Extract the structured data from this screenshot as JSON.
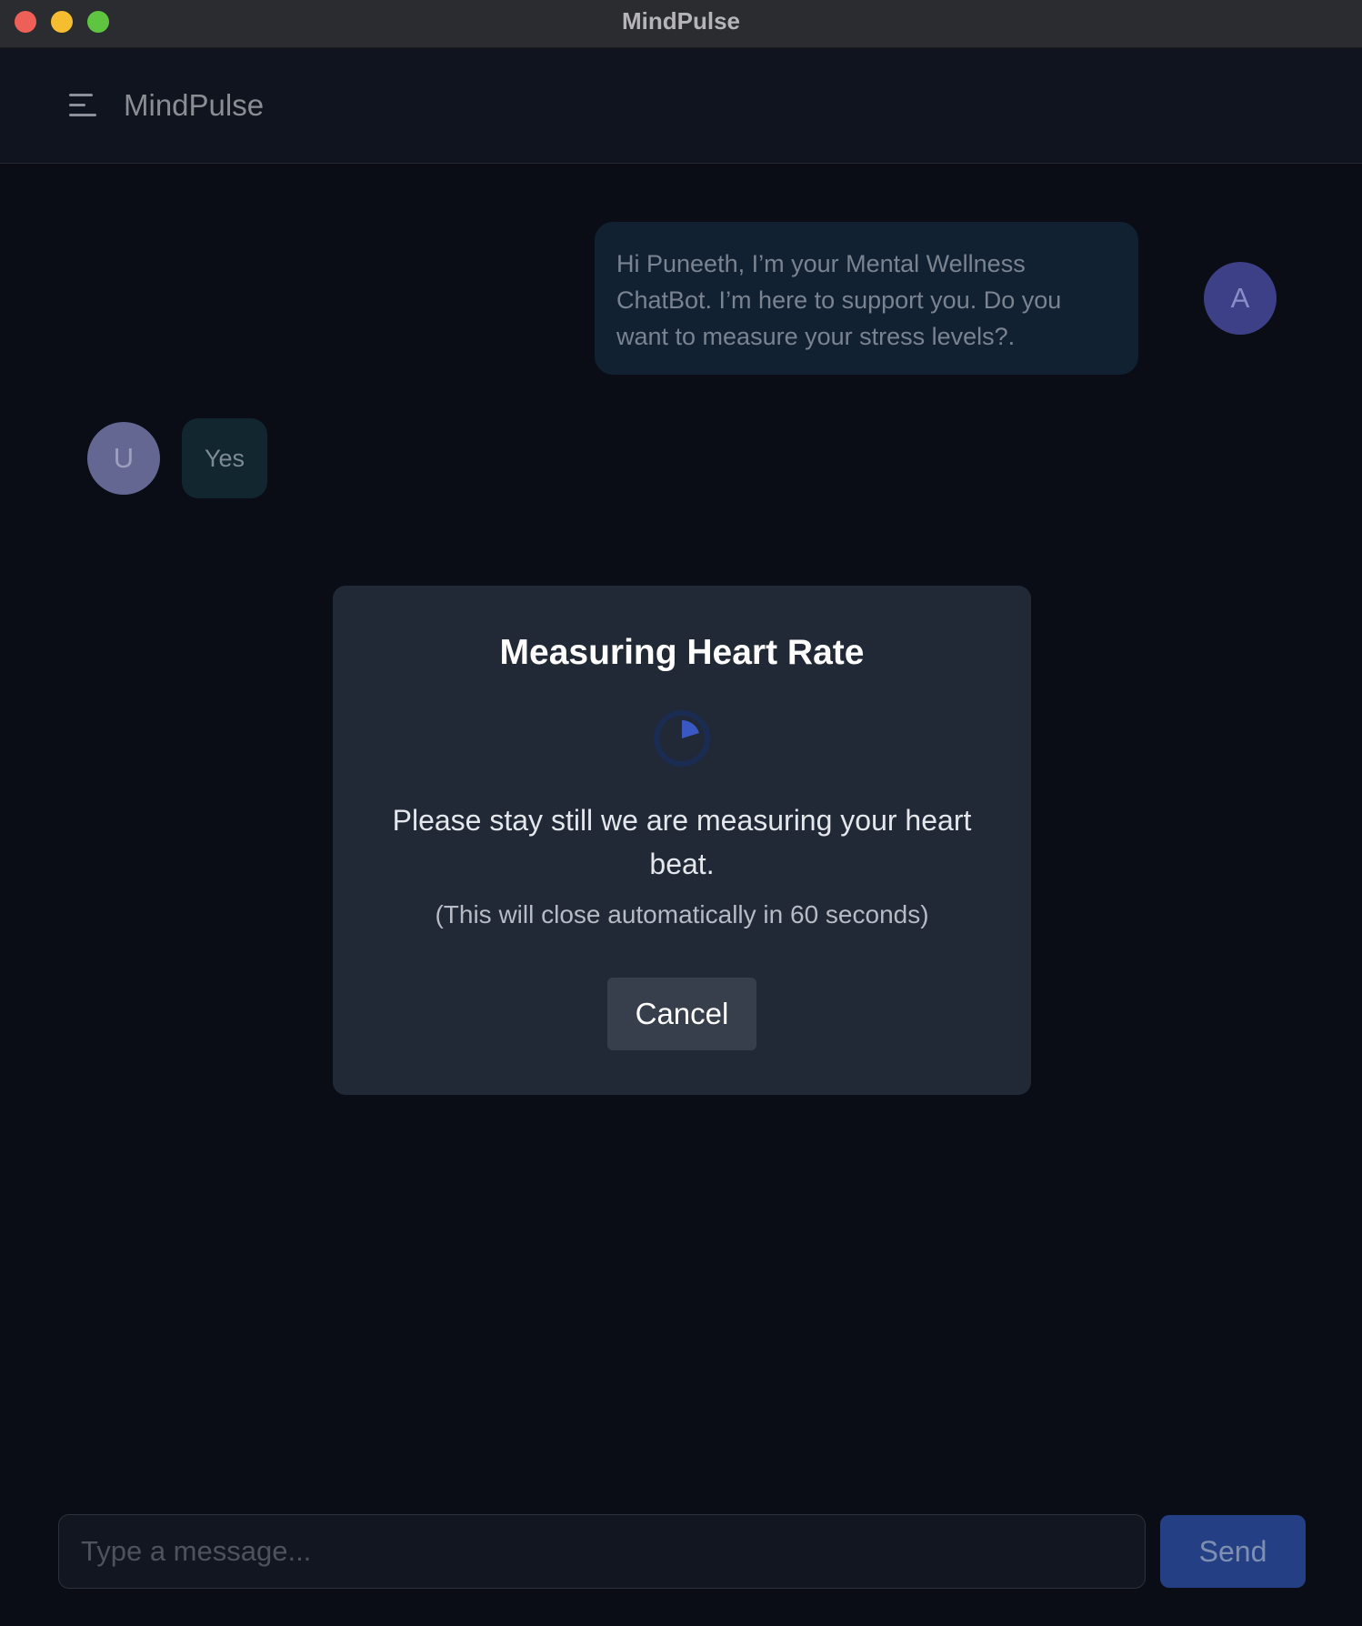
{
  "window": {
    "title": "MindPulse"
  },
  "header": {
    "app_name": "MindPulse",
    "menu_icon": "hamburger-menu-icon"
  },
  "messages": [
    {
      "sender": "bot",
      "avatar": "A",
      "text": "Hi Puneeth, I’m your Mental Wellness ChatBot. I’m here to support you. Do you want to measure your stress levels?."
    },
    {
      "sender": "user",
      "avatar": "U",
      "text": "Yes"
    }
  ],
  "modal": {
    "title": "Measuring Heart Rate",
    "spinner_icon": "loading-spinner-icon",
    "message": "Please stay still we are measuring your heart beat.",
    "subtext": "(This will close automatically in 60 seconds)",
    "cancel_label": "Cancel"
  },
  "composer": {
    "placeholder": "Type a message...",
    "value": "",
    "send_label": "Send"
  },
  "colors": {
    "background": "#0a0d15",
    "accent": "#253f84",
    "bot_avatar": "#3d3f87",
    "user_avatar": "#636792",
    "modal_bg": "#212836",
    "spinner": "#3a58c4"
  }
}
